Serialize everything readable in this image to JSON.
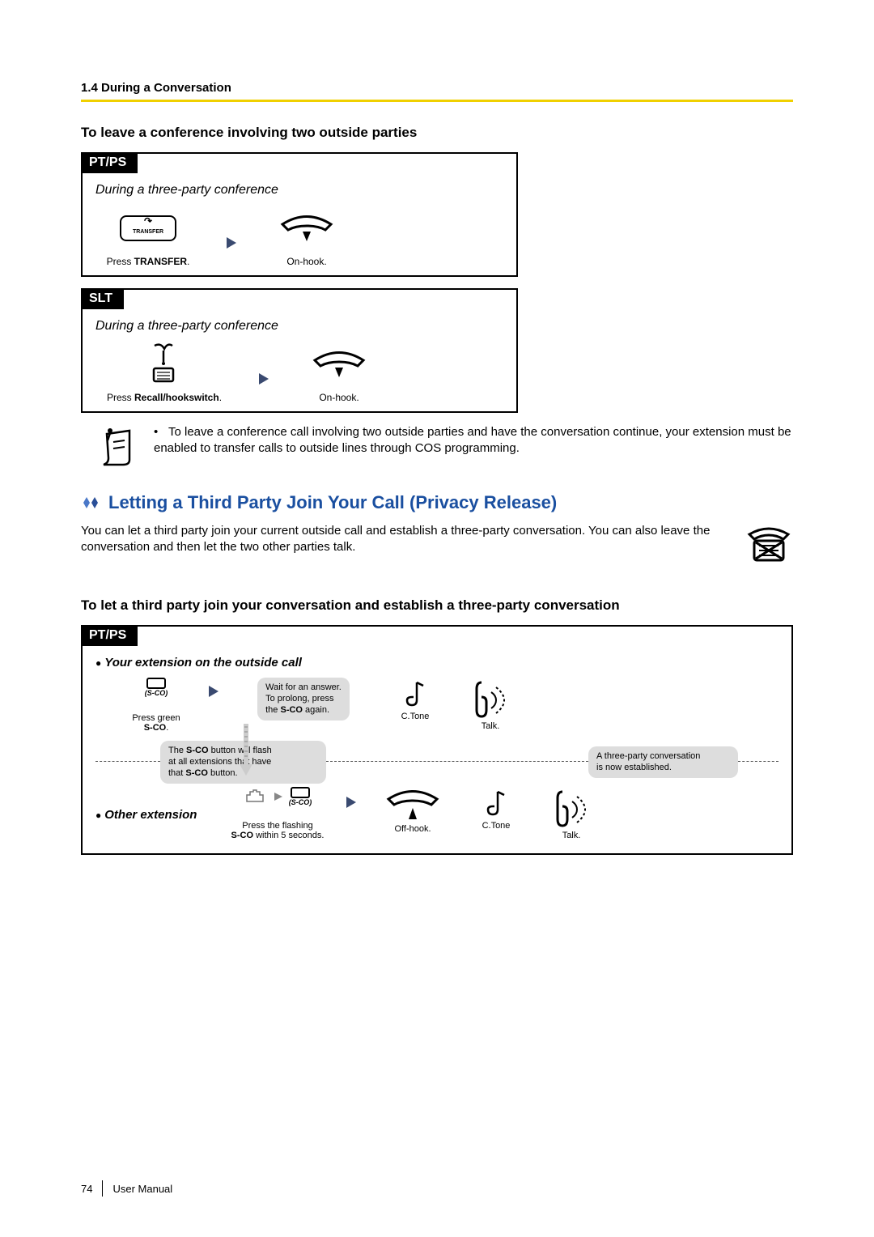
{
  "header": {
    "section": "1.4 During a Conversation"
  },
  "leave_conf": {
    "title": "To leave a conference involving two outside parties",
    "ptps": {
      "tab": "PT/PS",
      "subtitle": "During a three-party conference",
      "transfer_btn": "TRANSFER",
      "step1_pre": "Press ",
      "step1_bold": "TRANSFER",
      "step1_post": ".",
      "step2": "On-hook."
    },
    "slt": {
      "tab": "SLT",
      "subtitle": "During a three-party conference",
      "step1_pre": "Press ",
      "step1_bold": "Recall/hookswitch",
      "step1_post": ".",
      "step2": "On-hook."
    },
    "note_bullet": "•",
    "note": "To leave a conference call involving two outside parties and have the conversation continue, your extension must be enabled to transfer calls to outside lines through COS programming."
  },
  "privacy": {
    "heading": "Letting a Third Party Join Your Call (Privacy Release)",
    "intro": "You can let a third party join your current outside call and establish a three-party conversation. You can also leave the conversation and then let the two other parties talk.",
    "subheading": "To let a third party join your conversation and establish a three-party conversation",
    "tab": "PT/PS",
    "row1": {
      "title": "Your extension on the outside call",
      "sco_label": "(S-CO)",
      "step1_line1": "Press green",
      "step1_bold": "S-CO",
      "step1_post": ".",
      "callout1_l1": "Wait for an answer.",
      "callout1_l2": "To prolong, press",
      "callout1_l3a": "the ",
      "callout1_l3b": "S-CO",
      "callout1_l3c": " again.",
      "ctone": "C.Tone",
      "talk": "Talk."
    },
    "divider": {
      "left_pre": "The ",
      "left_bold": "S-CO",
      "left_post1": " button will flash",
      "left_l2": "at all extensions that have",
      "left_l3a": "that ",
      "left_l3b": "S-CO",
      "left_l3c": " button.",
      "right_l1": "A three-party conversation",
      "right_l2": "is now established."
    },
    "row2": {
      "title": "Other extension",
      "sco_label": "(S-CO)",
      "step1_l1": "Press the flashing",
      "step1_bold": "S-CO",
      "step1_post": " within 5 seconds.",
      "offhook": "Off-hook.",
      "ctone": "C.Tone",
      "talk": "Talk."
    }
  },
  "footer": {
    "page": "74",
    "label": "User Manual"
  }
}
